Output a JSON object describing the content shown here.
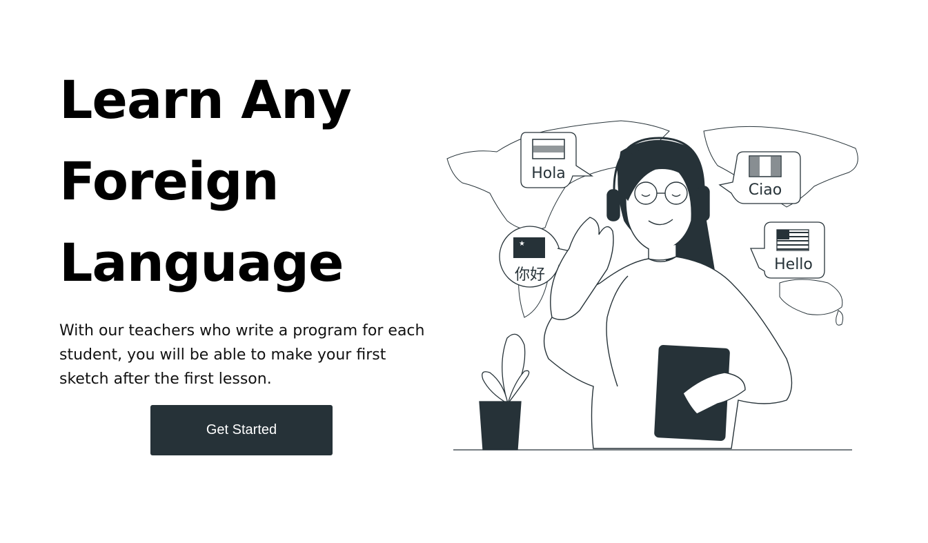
{
  "hero": {
    "title_lines": [
      "Learn Any",
      "Foreign",
      "Language"
    ],
    "description": "With our teachers who write a program for each student, you will be able to make your first sketch after the first lesson.",
    "cta_label": "Get Started"
  },
  "illustration": {
    "bubbles": {
      "spanish": "Hola",
      "italian": "Ciao",
      "chinese": "你好",
      "english": "Hello"
    }
  },
  "colors": {
    "ink": "#263238",
    "background": "#ffffff",
    "text": "#000000"
  }
}
